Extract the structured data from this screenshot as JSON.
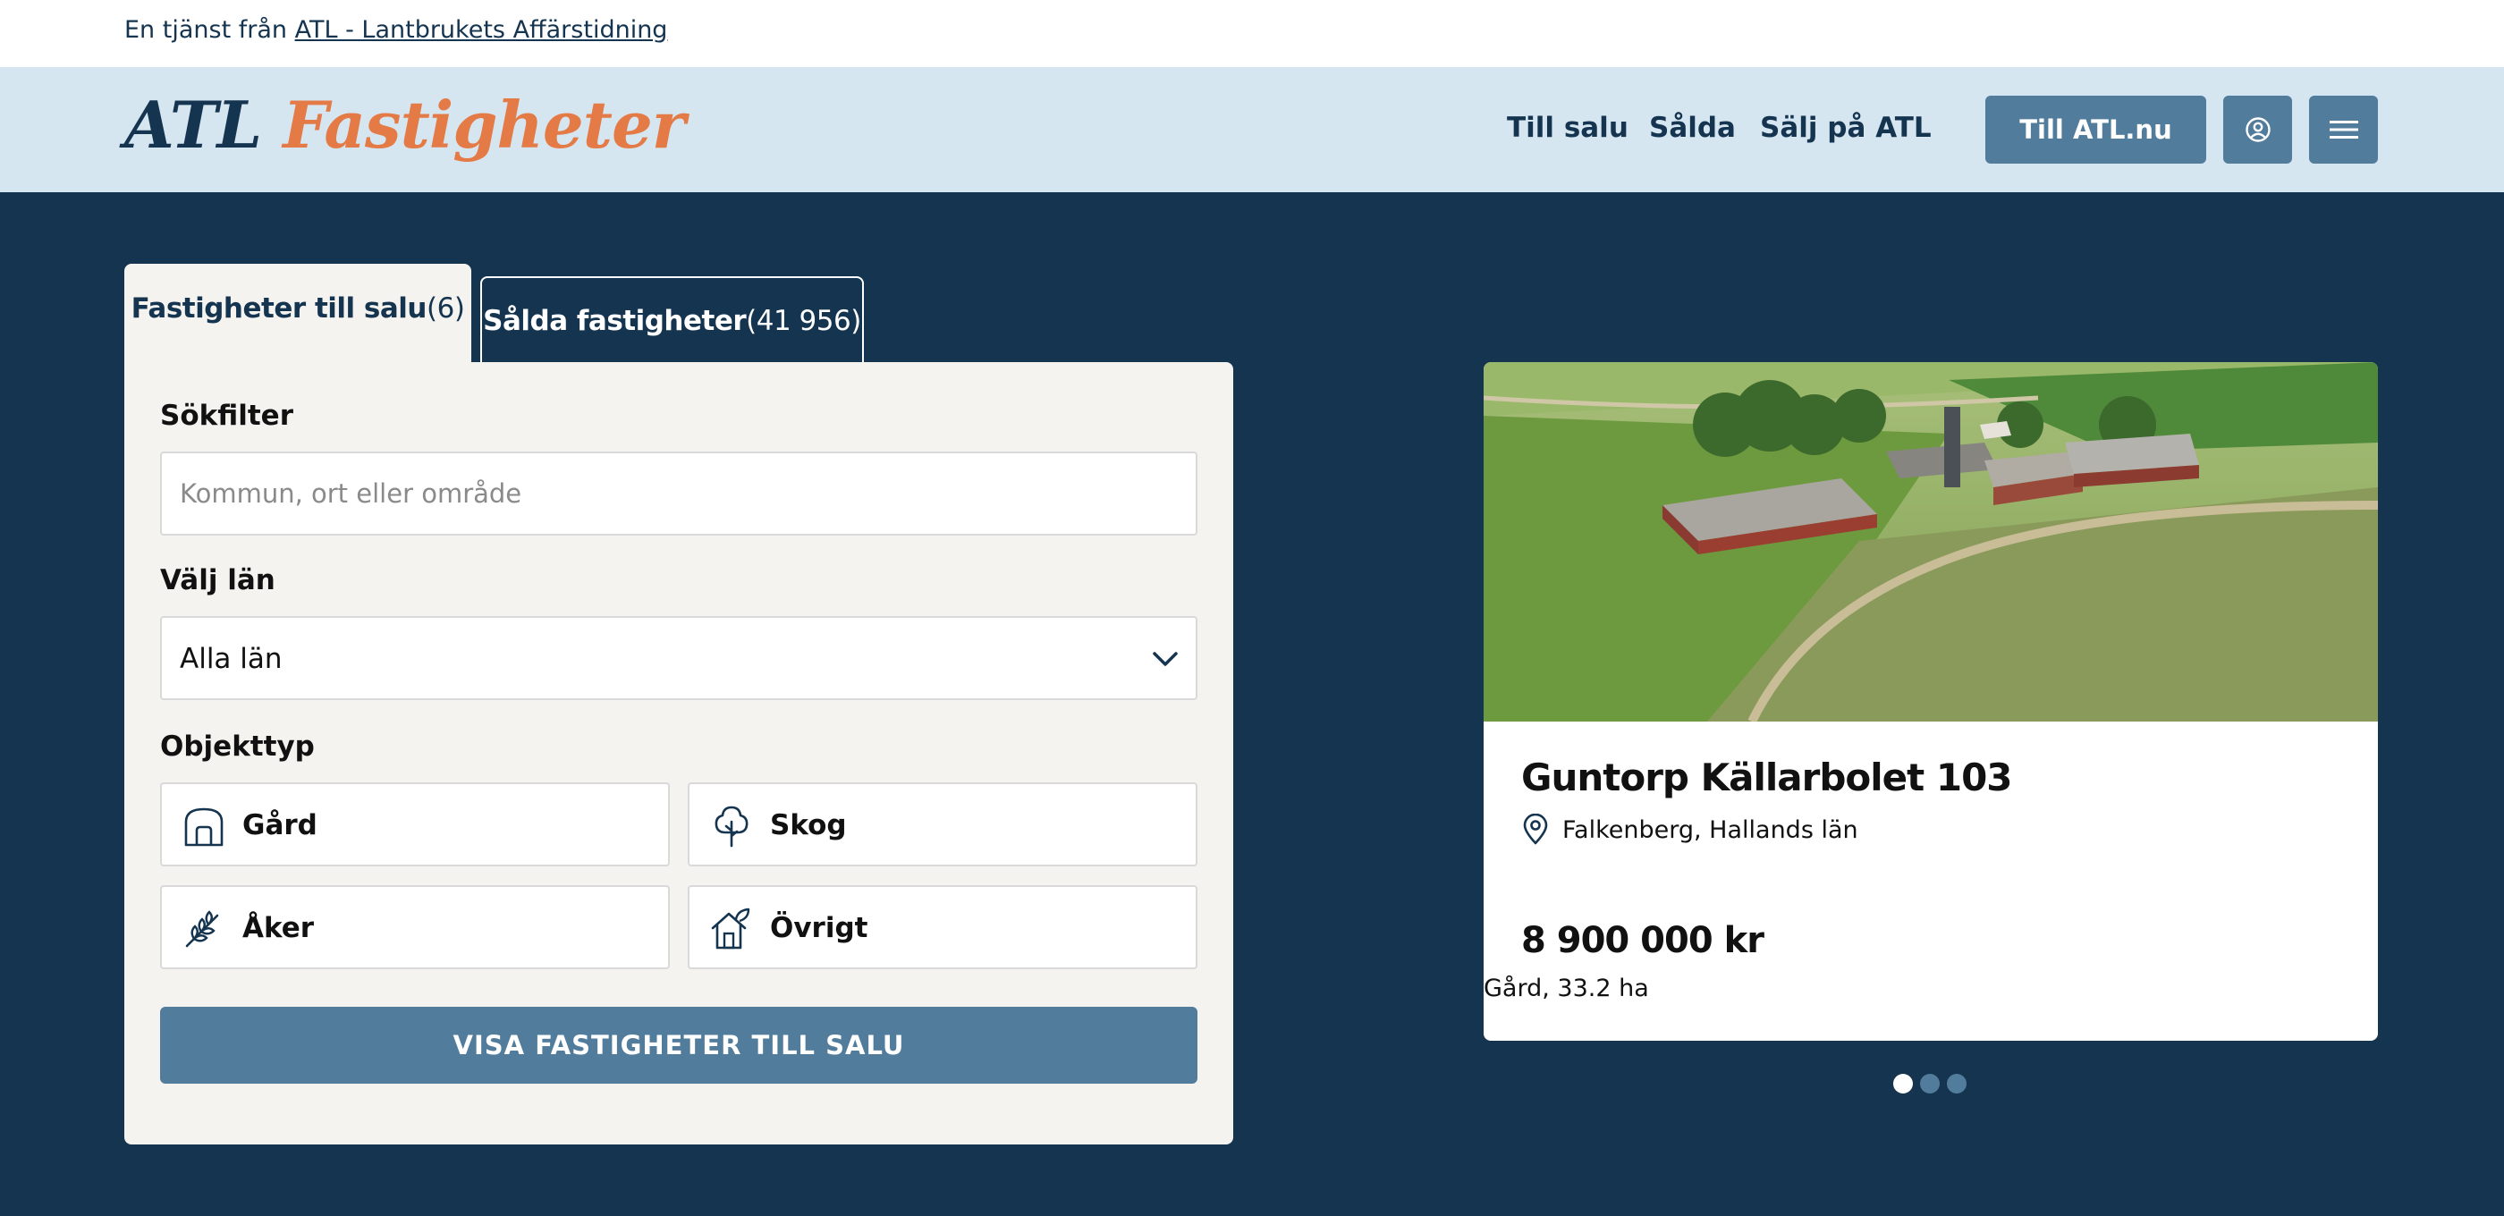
{
  "topbar": {
    "intro": "En tjänst från",
    "link": "ATL - Lantbrukets Affärstidning"
  },
  "header": {
    "logo_part1": "ATL",
    "logo_part2": "Fastigheter",
    "nav": [
      "Till salu",
      "Sålda",
      "Sälj på ATL"
    ],
    "cta": "Till ATL.nu",
    "icons": [
      "user-icon",
      "menu-icon"
    ]
  },
  "tabs": {
    "active": {
      "label": "Fastigheter till salu",
      "count": "(6)"
    },
    "inactive": {
      "label": "Sålda fastigheter",
      "count": "(41 956)"
    }
  },
  "search": {
    "filter_label": "Sökfilter",
    "placeholder": "Kommun, ort eller område",
    "lan_label": "Välj län",
    "lan_value": "Alla län",
    "type_label": "Objekttyp",
    "types": [
      {
        "label": "Gård",
        "icon": "barn-icon"
      },
      {
        "label": "Skog",
        "icon": "tree-icon"
      },
      {
        "label": "Åker",
        "icon": "wheat-icon"
      },
      {
        "label": "Övrigt",
        "icon": "house-icon"
      }
    ],
    "submit": "VISA FASTIGHETER TILL SALU"
  },
  "listing": {
    "title": "Guntorp Källarbolet 103",
    "location": "Falkenberg, Hallands län",
    "price": "8 900 000 kr",
    "details": "Gård, 33.2 ha"
  },
  "carousel": {
    "total": 3,
    "active": 1
  },
  "colors": {
    "navy": "#15344f",
    "light_blue": "#d6e6f1",
    "button_blue": "#517c9c",
    "orange": "#e47b46",
    "panel": "#f5f3ef"
  }
}
